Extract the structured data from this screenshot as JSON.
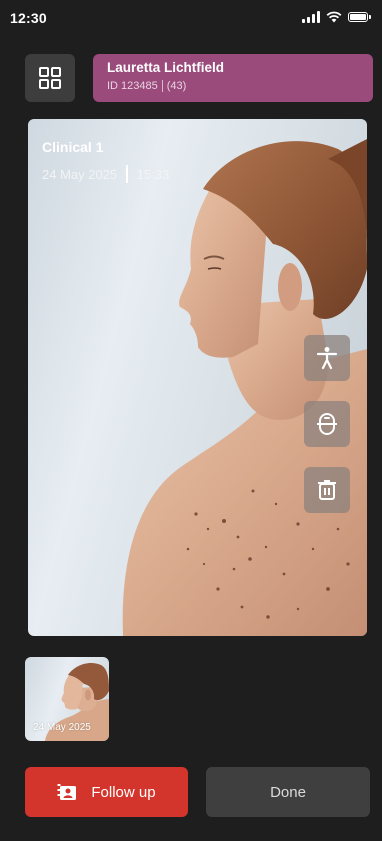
{
  "status_bar": {
    "time": "12:30",
    "icons": [
      "signal-icon",
      "wifi-icon",
      "battery-icon"
    ]
  },
  "header": {
    "menu_icon": "grid-icon",
    "patient": {
      "name": "Lauretta Lichtfield",
      "id": "ID 123485",
      "age": "(43)",
      "color": "#9a4a7b"
    }
  },
  "photo": {
    "title": "Clinical 1",
    "date": "24 May 2025",
    "time": "15:33",
    "tools": [
      "body-map-icon",
      "dermatoscope-icon",
      "trash-icon"
    ]
  },
  "thumbnails": [
    {
      "date": "24 May 2025"
    }
  ],
  "actions": {
    "follow_up": {
      "label": "Follow up",
      "icon": "follow-up-icon",
      "color": "#d3342b"
    },
    "done": {
      "label": "Done",
      "color": "#3f3f3f"
    }
  }
}
